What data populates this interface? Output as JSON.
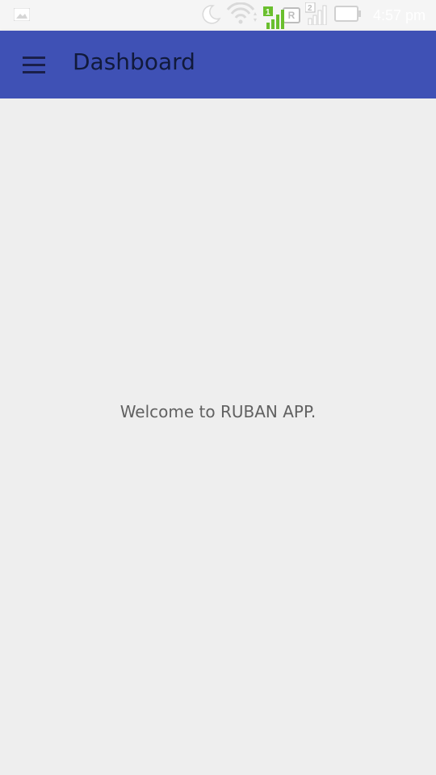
{
  "status_bar": {
    "time": "4:57 pm",
    "sim1_label": "1",
    "sim2_label": "2",
    "roaming_label": "R",
    "icons": [
      "gallery-icon",
      "moon-icon",
      "wifi-icon",
      "signal-icon",
      "battery-icon"
    ],
    "colors": {
      "sim1": "#6abf2e",
      "inactive": "#bdbdbd"
    }
  },
  "app_bar": {
    "title": "Dashboard",
    "menu_icon": "hamburger-menu-icon",
    "color": "#3f51b5"
  },
  "main": {
    "welcome_text": "Welcome to RUBAN APP."
  }
}
